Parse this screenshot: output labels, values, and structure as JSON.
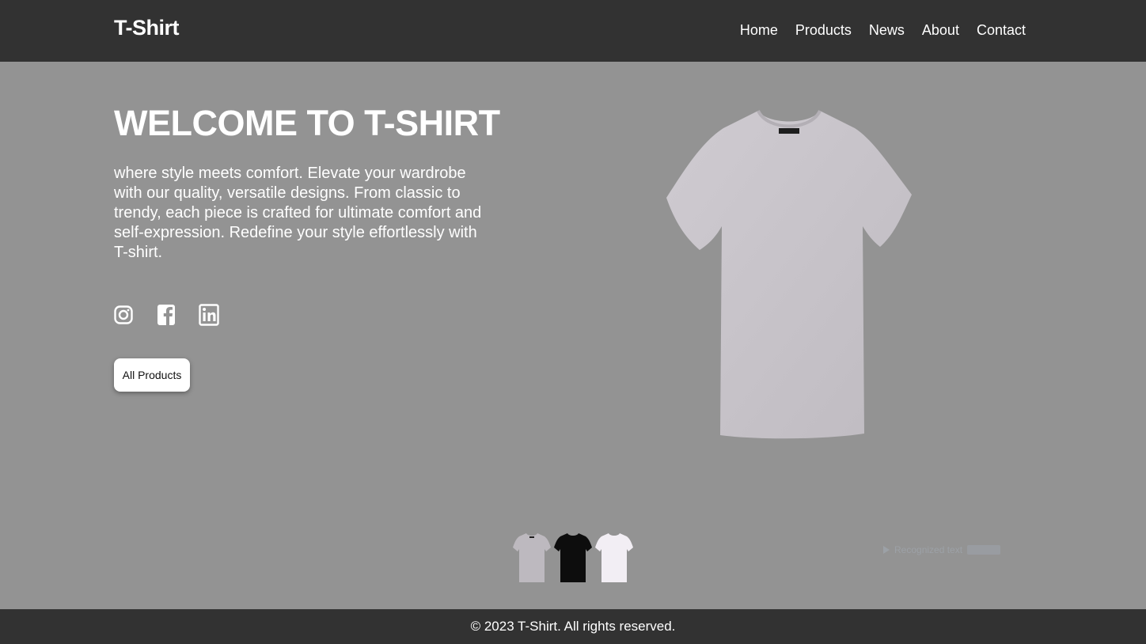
{
  "header": {
    "brand": "T-Shirt",
    "nav": [
      "Home",
      "Products",
      "News",
      "About",
      "Contact"
    ]
  },
  "hero": {
    "title": "WELCOME TO T-SHIRT",
    "text": "where style meets comfort. Elevate your wardrobe with our quality, versatile designs. From classic to trendy, each piece is crafted for ultimate comfort and self-expression. Redefine your style effortlessly with T-shirt.",
    "cta_label": "All Products",
    "social_icons": [
      "instagram-icon",
      "facebook-icon",
      "linkedin-icon"
    ]
  },
  "product": {
    "main_color": "#c7c3c9",
    "thumbnails": [
      {
        "name": "grey-tshirt",
        "color": "#bdb9bf"
      },
      {
        "name": "black-tshirt",
        "color": "#0d0d0d"
      },
      {
        "name": "white-tshirt",
        "color": "#f2eef4"
      }
    ]
  },
  "overlay": {
    "label": "Recognized text"
  },
  "footer": {
    "copyright": "© 2023 T-Shirt. All rights reserved."
  },
  "colors": {
    "header_bg": "#323232",
    "page_bg": "#939393",
    "text": "#ffffff"
  }
}
